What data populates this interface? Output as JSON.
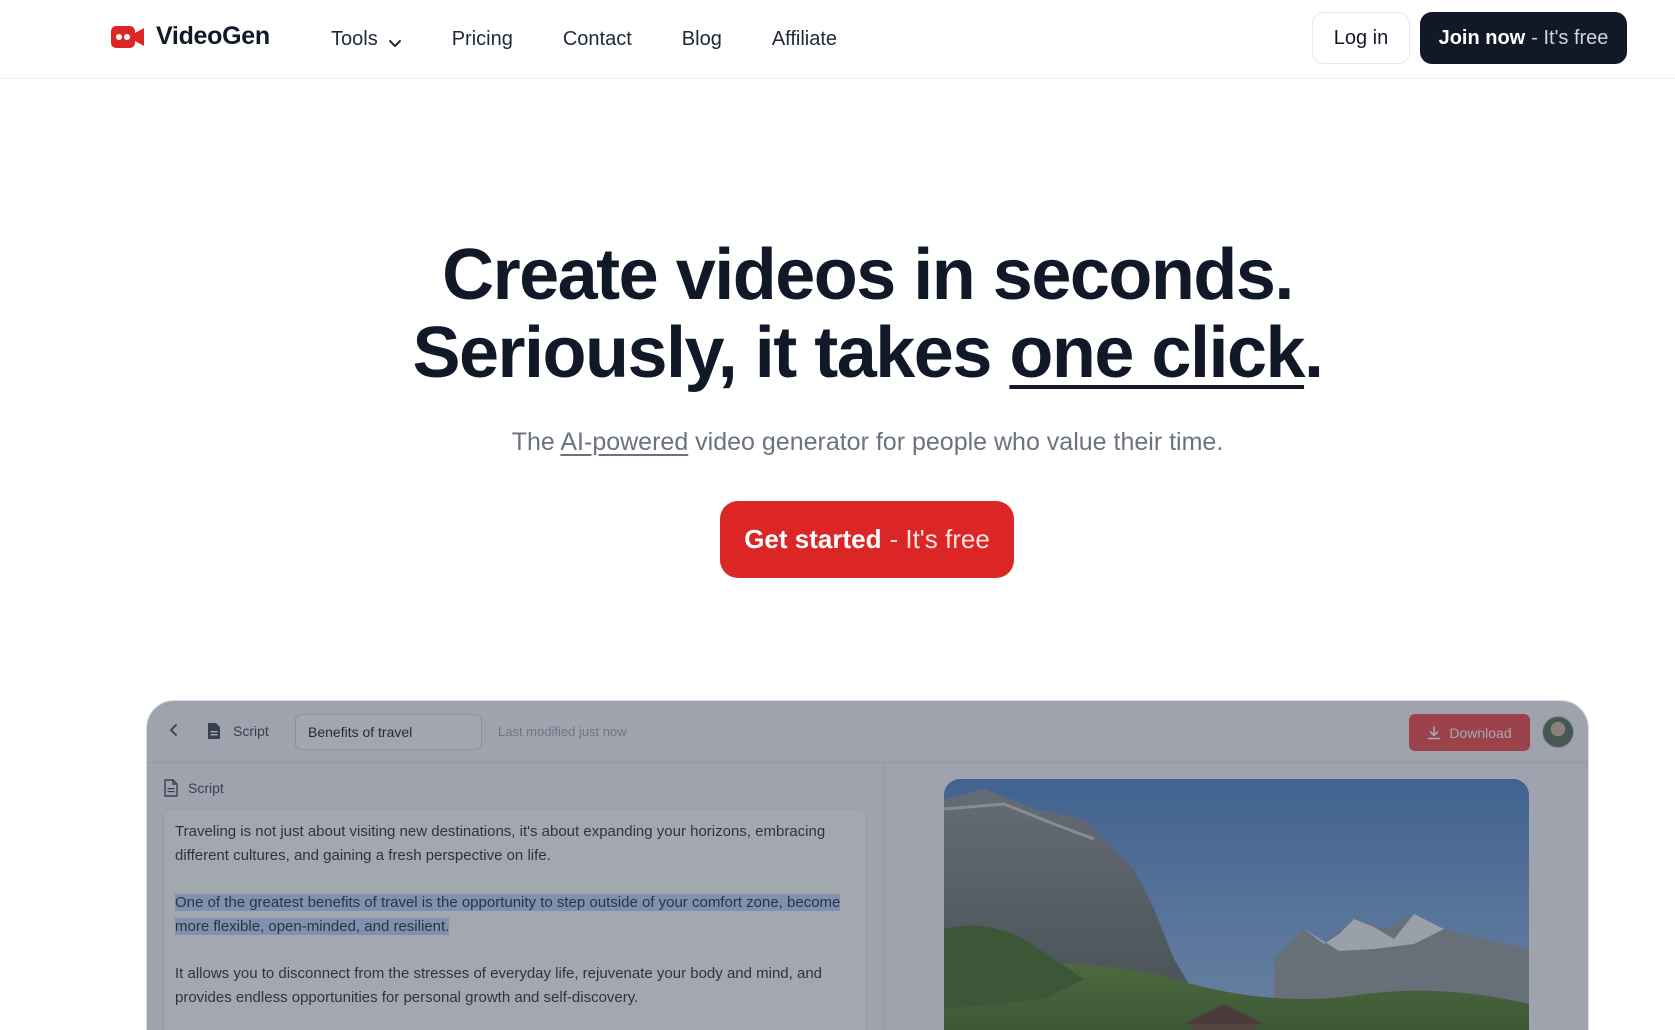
{
  "nav": {
    "brand": "VideoGen",
    "links": [
      "Tools",
      "Pricing",
      "Contact",
      "Blog",
      "Affiliate"
    ],
    "login_label": "Log in",
    "join_strong": "Join now",
    "join_light": "- It's free"
  },
  "hero": {
    "title_line1": "Create videos in seconds.",
    "title_line2_prefix": "Seriously, it takes ",
    "title_line2_underlined": "one click",
    "title_line2_suffix": ".",
    "subtitle_prefix": "The ",
    "subtitle_link": "AI-powered",
    "subtitle_suffix": " video generator for people who value their time.",
    "cta_strong": "Get started",
    "cta_light": "- It's free"
  },
  "preview": {
    "script_label": "Script",
    "title_value": "Benefits of travel",
    "last_modified": "Last modified just now",
    "download_label": "Download",
    "panel_label": "Script",
    "paragraphs": [
      "Traveling is not just about visiting new destinations, it's about expanding your horizons, embracing different cultures, and gaining a fresh perspective on life.",
      "One of the greatest benefits of travel is the opportunity to step outside of your comfort zone, become more flexible, open-minded, and resilient.",
      "It allows you to disconnect from the stresses of everyday life, rejuvenate your body and mind, and provides endless opportunities for personal growth and self-discovery."
    ]
  },
  "colors": {
    "brand_red": "#dc2626",
    "dark": "#111827",
    "highlight": "#bcd3f7"
  },
  "icons": [
    "video-camera-logo-icon",
    "chevron-down-icon",
    "chevron-left-icon",
    "document-icon",
    "download-icon"
  ]
}
